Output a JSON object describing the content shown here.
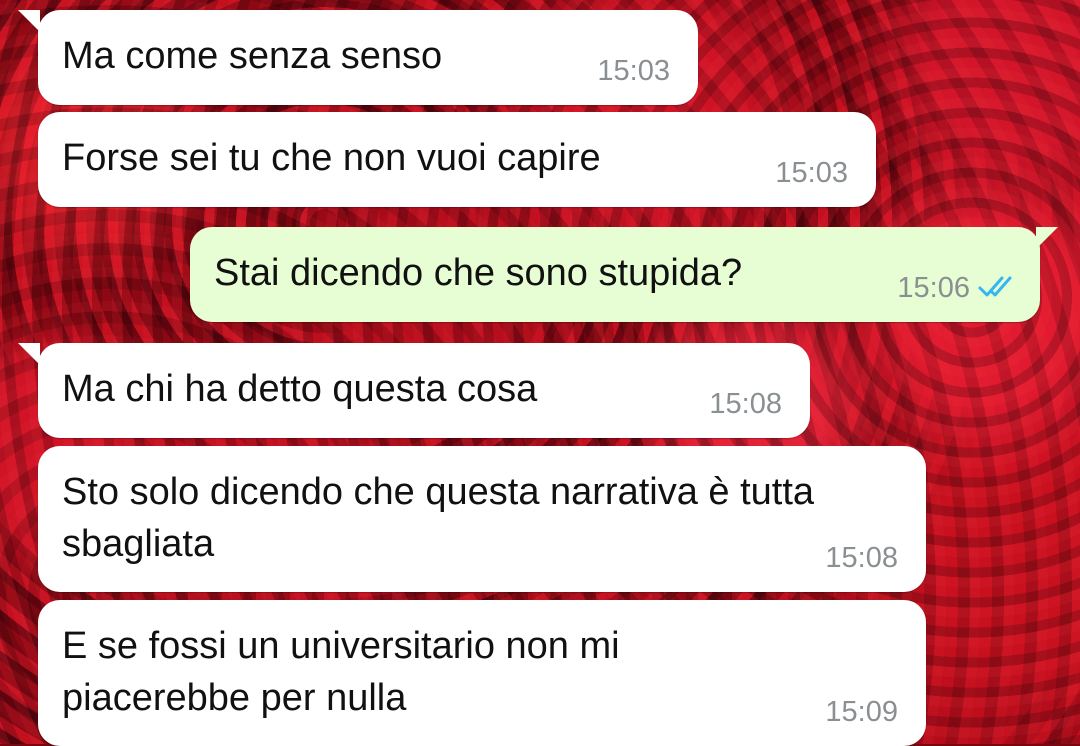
{
  "chat": {
    "messages": [
      {
        "direction": "incoming",
        "text": "Ma come senza senso",
        "time": "15:03"
      },
      {
        "direction": "incoming",
        "text": "Forse sei tu che non vuoi capire",
        "time": "15:03"
      },
      {
        "direction": "outgoing",
        "text": "Stai dicendo che sono stupida?",
        "time": "15:06",
        "status_icon": "double-check-read-icon",
        "status_color": "#34b7f1"
      },
      {
        "direction": "incoming",
        "text": "Ma chi ha detto questa cosa",
        "time": "15:08"
      },
      {
        "direction": "incoming",
        "text": "Sto solo dicendo che questa narrativa è tutta sbagliata",
        "time": "15:08"
      },
      {
        "direction": "incoming",
        "text": "E se fossi un universitario non mi piacerebbe per nulla",
        "time": "15:09"
      }
    ]
  },
  "theme": {
    "incoming_bubble": "#ffffff",
    "outgoing_bubble": "#e7fdd3",
    "timestamp_color": "#8a8f92",
    "wallpaper": "red-roses"
  }
}
